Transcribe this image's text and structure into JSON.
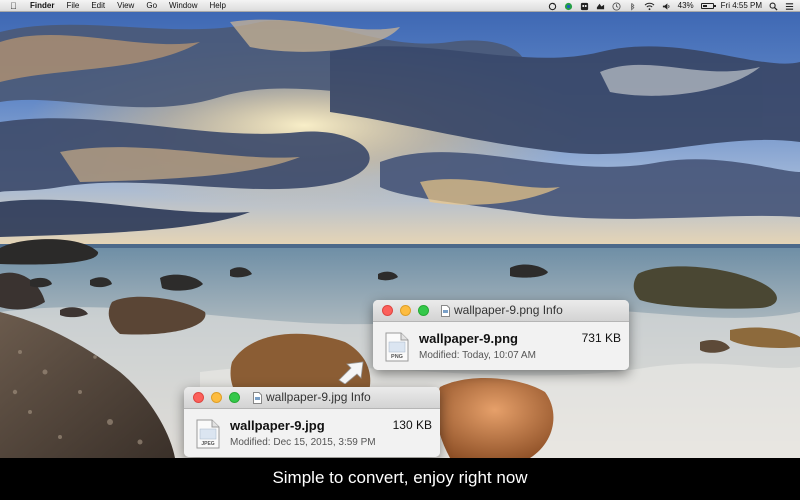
{
  "menubar": {
    "app_name": "Finder",
    "menus": [
      "File",
      "Edit",
      "View",
      "Go",
      "Window",
      "Help"
    ],
    "battery_percent": "43%",
    "battery_level": 0.43,
    "clock": "Fri 4:55 PM",
    "status_icons": [
      "sync-icon",
      "recording-icon",
      "owl-icon",
      "timer-icon",
      "bluetooth-icon",
      "wifi-icon",
      "volume-icon",
      "battery-icon",
      "search-icon",
      "list-icon"
    ]
  },
  "windows": {
    "png": {
      "title": "wallpaper-9.png Info",
      "file_name": "wallpaper-9.png",
      "file_size": "731 KB",
      "modified": "Modified: Today, 10:07 AM",
      "icon_label": "PNG"
    },
    "jpg": {
      "title": "wallpaper-9.jpg Info",
      "file_name": "wallpaper-9.jpg",
      "file_size": "130 KB",
      "modified": "Modified: Dec 15, 2015, 3:59 PM",
      "icon_label": "JPEG"
    }
  },
  "caption": "Simple to convert, enjoy right now",
  "colors": {
    "sky_top": "#2f5da8",
    "sea": "#6f8fa6",
    "sunset_glow": "#f3c77b",
    "caption_bg": "#000000",
    "traffic_close": "#fc605b",
    "traffic_min": "#fdbc40",
    "traffic_max": "#34c84a"
  }
}
